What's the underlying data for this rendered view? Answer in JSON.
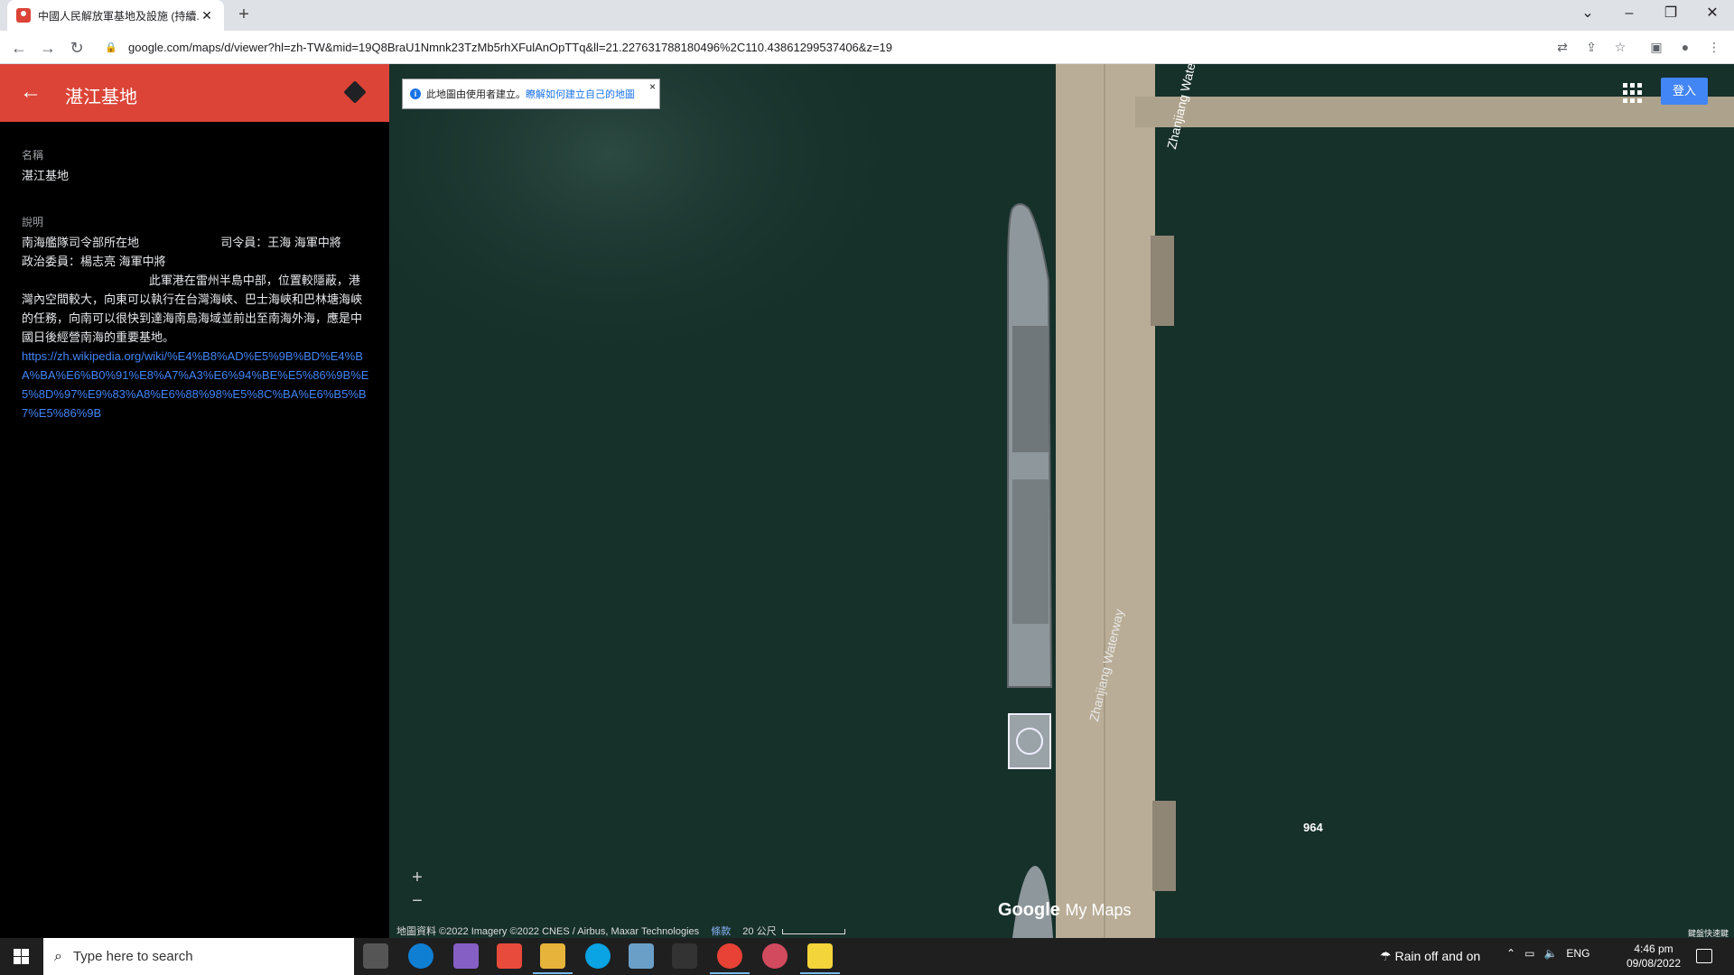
{
  "browser": {
    "tab_title": "中國人民解放軍基地及設施 (持續...",
    "url": "google.com/maps/d/viewer?hl=zh-TW&mid=19Q8BraU1Nmnk23TzMb5rhXFulAnOpTTq&ll=21.227631788180496%2C110.43861299537406&z=19"
  },
  "panel": {
    "title": "湛江基地",
    "name_label": "名稱",
    "name_value": "湛江基地",
    "desc_label": "說明",
    "desc_text": "南海艦隊司令部所在地                         司令員：王海 海軍中將\n政治委員：楊志亮 海軍中將\n                                       此軍港在雷州半島中部，位置較隱蔽，港灣內空間較大，向東可以執行在台灣海峽、巴士海峽和巴林塘海峽的任務，向南可以很快到達海南島海域並前出至南海外海，應是中國日後經營南海的重要基地。",
    "desc_link": "https://zh.wikipedia.org/wiki/%E4%B8%AD%E5%9B%BD%E4%BA%BA%E6%B0%91%E8%A7%A3%E6%94%BE%E5%86%9B%E5%8D%97%E9%83%A8%E6%88%98%E5%8C%BA%E6%B5%B7%E5%86%9B"
  },
  "map": {
    "info_text": "此地圖由使用者建立。",
    "info_link": "瞭解如何建立自己的地圖",
    "info_close": "×",
    "signin": "登入",
    "zoom_in": "+",
    "zoom_out": "−",
    "road_label_1": "Zhanjiang Waterway",
    "road_label_2": "Zhanjiang Waterway",
    "hull_number": "964",
    "logo_google": "Google",
    "logo_mymaps": "My Maps",
    "attribution": "地圖資料 ©2022 Imagery ©2022 CNES / Airbus, Maxar Technologies",
    "terms": "條款",
    "scale": "20 公尺",
    "keyboard": "鍵盤快速鍵",
    "colors": {
      "water": "#16302a",
      "pier": "#b9ad97",
      "ship": "#8e979b"
    }
  },
  "taskbar": {
    "search_placeholder": "Type here to search",
    "weather": "Rain off and on",
    "lang": "ENG",
    "time": "4:46 pm",
    "date": "09/08/2022"
  }
}
